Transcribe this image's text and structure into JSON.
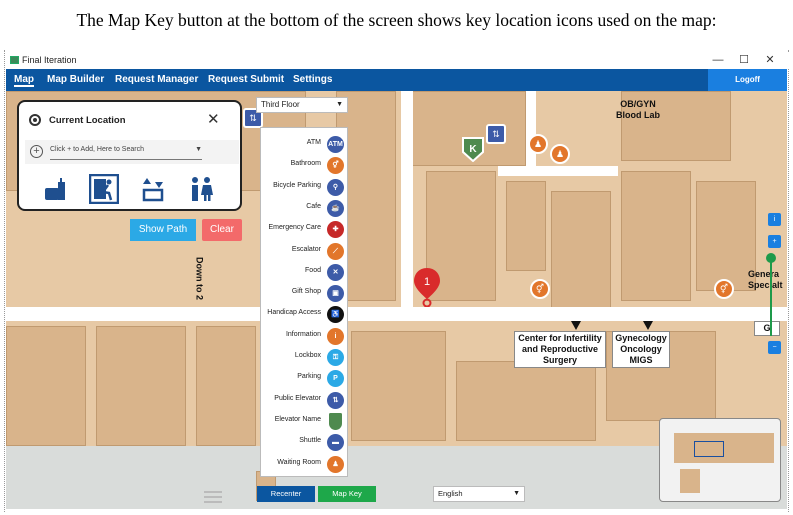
{
  "caption": "The Map Key button at the bottom of the screen shows key location icons used on the map:",
  "window": {
    "title": "Final Iteration",
    "minimize": "—",
    "maximize": "☐",
    "close": "✕"
  },
  "menu": {
    "items": [
      "Map",
      "Map Builder",
      "Request Manager",
      "Request Submit",
      "Settings"
    ],
    "logoff": "Logoff"
  },
  "floor_select": {
    "value": "Third Floor"
  },
  "current_location": {
    "title": "Current Location",
    "close": "✕",
    "search_placeholder": "Click + to Add, Here to Search",
    "quick_icons": [
      "food-icon",
      "exit-icon",
      "elevator-icon",
      "restroom-icon"
    ]
  },
  "buttons": {
    "show_path": "Show Path",
    "clear": "Clear",
    "recenter": "Recenter",
    "map_key": "Map Key"
  },
  "language": {
    "value": "English"
  },
  "legend": [
    {
      "label": "ATM",
      "icon": "atm-icon",
      "color": "#3d5ba8",
      "glyph": "ATM"
    },
    {
      "label": "Bathroom",
      "icon": "bathroom-icon",
      "color": "#e2762b",
      "glyph": "⚥"
    },
    {
      "label": "Bicycle Parking",
      "icon": "bicycle-icon",
      "color": "#3d5ba8",
      "glyph": "⚲"
    },
    {
      "label": "Cafe",
      "icon": "cafe-icon",
      "color": "#3d5ba8",
      "glyph": "☕"
    },
    {
      "label": "Emergency Care",
      "icon": "emergency-icon",
      "color": "#c62828",
      "glyph": "✚"
    },
    {
      "label": "Escalator",
      "icon": "escalator-icon",
      "color": "#e2762b",
      "glyph": "⟋"
    },
    {
      "label": "Food",
      "icon": "food-icon",
      "color": "#3d5ba8",
      "glyph": "✕"
    },
    {
      "label": "Gift Shop",
      "icon": "gift-icon",
      "color": "#3d5ba8",
      "glyph": "▣"
    },
    {
      "label": "Handicap Access",
      "icon": "handicap-icon",
      "color": "#111111",
      "glyph": "♿"
    },
    {
      "label": "Information",
      "icon": "information-icon",
      "color": "#e2762b",
      "glyph": "i"
    },
    {
      "label": "Lockbox",
      "icon": "lockbox-icon",
      "color": "#2ba9e6",
      "glyph": "⚿"
    },
    {
      "label": "Parking",
      "icon": "parking-icon",
      "color": "#2ba9e6",
      "glyph": "P"
    },
    {
      "label": "Public Elevator",
      "icon": "elevator-icon",
      "color": "#3d5ba8",
      "glyph": "⇅"
    },
    {
      "label": "Elevator Name",
      "icon": "elevator-name-icon",
      "color": "#4f8a4f",
      "glyph": ""
    },
    {
      "label": "Shuttle",
      "icon": "shuttle-icon",
      "color": "#3d5ba8",
      "glyph": "▬"
    },
    {
      "label": "Waiting Room",
      "icon": "waiting-room-icon",
      "color": "#e2762b",
      "glyph": "♟"
    }
  ],
  "map": {
    "pin_number": "1",
    "labels": {
      "obgyn": "OB/GYN\nBlood Lab",
      "infertility": "Center for Infertility\nand Reproductive\nSurgery",
      "gyn_onc": "Gynecology\nOncology\nMIGS",
      "general": "Genera\nSpecialt",
      "down_to_2": "Down to 2",
      "g_label": "G",
      "elevator_letter": "K"
    }
  },
  "zoom": {
    "info": "i",
    "plus": "+",
    "minus": "−"
  }
}
